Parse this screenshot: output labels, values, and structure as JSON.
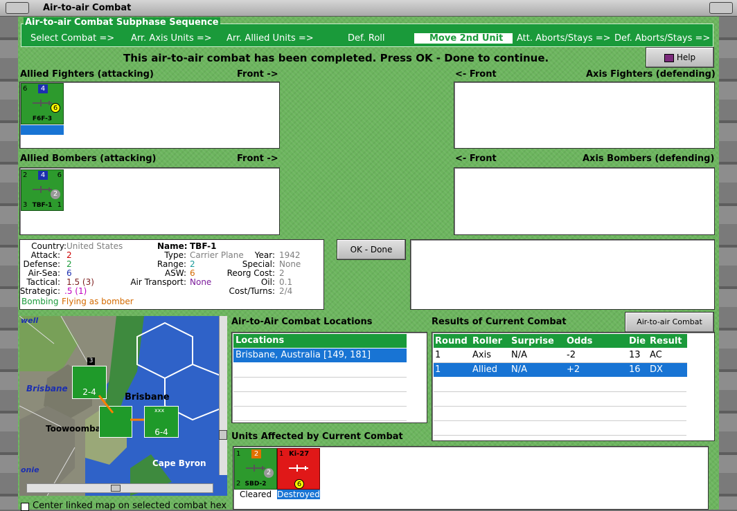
{
  "window": {
    "title": "Air-to-air Combat"
  },
  "phase": {
    "title": "Air-to-air Combat Subphase Sequence",
    "steps": [
      "Select Combat =>",
      "Arr. Axis Units =>",
      "Arr. Allied Units =>",
      "Def. Roll",
      "Move 2nd Unit",
      "Att. Aborts/Stays =>",
      "Def. Aborts/Stays =>"
    ],
    "active": "Move 2nd Unit"
  },
  "message": "This air-to-air combat has been completed.  Press OK - Done to continue.",
  "help_label": "Help",
  "panels": {
    "allied_fighters": "Allied Fighters (attacking)",
    "allied_bombers": "Allied Bombers (attacking)",
    "axis_fighters": "Axis Fighters (defending)",
    "axis_bombers": "Axis Bombers (defending)",
    "front_right": "Front ->",
    "front_left": "<- Front"
  },
  "counters": {
    "f6f": {
      "name": "F6F-3",
      "strength": "6",
      "nation": "4",
      "range": "6"
    },
    "tbf": {
      "name": "TBF-1",
      "strength": "2",
      "nation": "4",
      "def": "6",
      "range": "2",
      "bl": "3",
      "br": "1"
    },
    "sbd": {
      "name": "SBD-2",
      "strength": "1",
      "nation": "2",
      "range": "2",
      "bl": "2",
      "status": "Cleared"
    },
    "ki27": {
      "name": "Ki-27",
      "strength": "1",
      "range": "6",
      "status": "Destroyed"
    }
  },
  "unit_info": {
    "country_label": "Country:",
    "country": "United States",
    "attack_label": "Attack:",
    "attack": "2",
    "defense_label": "Defense:",
    "defense": "2",
    "airsea_label": "Air-Sea:",
    "airsea": "6",
    "tactical_label": "Tactical:",
    "tactical": "1.5 (3)",
    "strategic_label": "Strategic:",
    "strategic": ".5 (1)",
    "bombing": "Bombing",
    "flying": "Flying as bomber",
    "name_label": "Name:",
    "name": "TBF-1",
    "type_label": "Type:",
    "type": "Carrier Plane",
    "year_label": "Year:",
    "year": "1942",
    "range_label": "Range:",
    "range": "2",
    "special_label": "Special:",
    "special": "None",
    "asw_label": "ASW:",
    "asw": "6",
    "reorg_label": "Reorg Cost:",
    "reorg": "2",
    "airtransport_label": "Air Transport:",
    "airtransport": "None",
    "oil_label": "Oil:",
    "oil": "0.1",
    "costturns_label": "Cost/Turns:",
    "costturns": "2/4"
  },
  "ok_label": "OK - Done",
  "chart_button": "Air-to-air Combat Chart",
  "locations": {
    "title": "Air-to-Air Combat Locations",
    "header": "Locations",
    "rows": [
      "Brisbane, Australia [149, 181]"
    ]
  },
  "results": {
    "title": "Results of Current Combat",
    "headers": [
      "Round",
      "Roller",
      "Surprise",
      "Odds",
      "Die",
      "Result"
    ],
    "rows": [
      [
        "1",
        "Axis",
        "N/A",
        "-2",
        "13",
        "AC"
      ],
      [
        "1",
        "Allied",
        "N/A",
        "+2",
        "16",
        "DX"
      ]
    ]
  },
  "affected_title": "Units Affected by Current Combat",
  "map": {
    "labels": {
      "brisbane": "Brisbane",
      "brisbane2": "Brisbane",
      "toowoomba": "Toowoomba",
      "cape": "Cape Byron",
      "top": "well",
      "left": "onie"
    },
    "c1": {
      "v": "2-4",
      "n": "3"
    },
    "c2": {
      "v": "6-4",
      "n": "xxx"
    }
  },
  "checkbox_label": "Center linked map on selected combat hex"
}
